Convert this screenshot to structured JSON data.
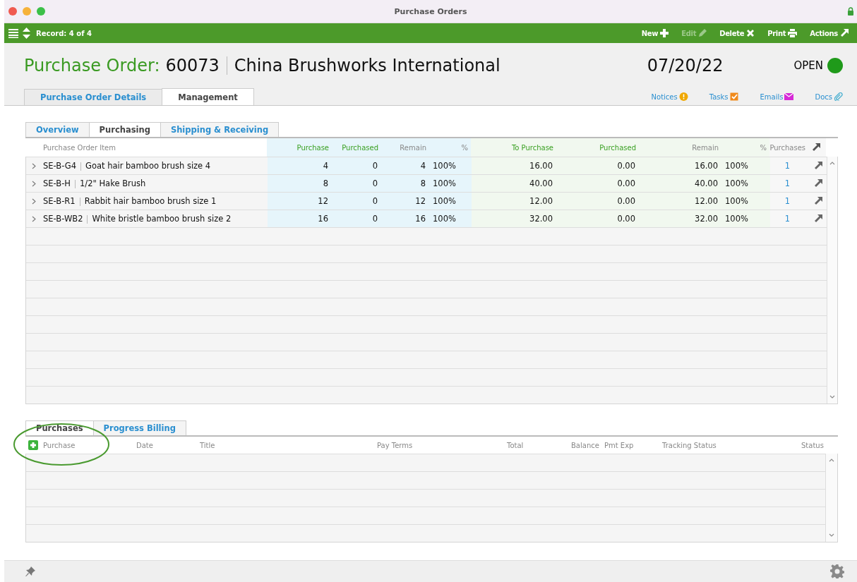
{
  "window": {
    "title": "Purchase Orders"
  },
  "toolbar": {
    "record": "Record: 4 of 4",
    "actions": [
      {
        "label": "New",
        "kind": "plus",
        "disabled": false
      },
      {
        "label": "Edit",
        "kind": "pencil",
        "disabled": true
      },
      {
        "label": "Delete",
        "kind": "cross",
        "disabled": false
      },
      {
        "label": "Print",
        "kind": "printer",
        "disabled": false
      },
      {
        "label": "Actions",
        "kind": "arrow",
        "disabled": false
      }
    ]
  },
  "header": {
    "label": "Purchase Order:",
    "number": "60073",
    "vendor": "China Brushworks International",
    "date": "07/20/22",
    "status": {
      "label": "OPEN",
      "kind": "open"
    }
  },
  "tabs": [
    {
      "label": "Purchase Order Details",
      "selected": false
    },
    {
      "label": "Management",
      "selected": true
    }
  ],
  "links": [
    {
      "label": "Notices",
      "kind": "notice"
    },
    {
      "label": "Tasks",
      "kind": "task"
    },
    {
      "label": "Emails",
      "kind": "email"
    },
    {
      "label": "Docs",
      "kind": "doc"
    }
  ],
  "subtabs": [
    {
      "label": "Overview",
      "selected": false
    },
    {
      "label": "Purchasing",
      "selected": true
    },
    {
      "label": "Shipping & Receiving",
      "selected": false
    }
  ],
  "items_table": {
    "columns": [
      {
        "label": "Purchase Order Item",
        "kind": "item",
        "highlighted": false
      },
      {
        "label": "Purchase",
        "kind": "quantity",
        "highlighted": true
      },
      {
        "label": "Purchased",
        "kind": "quantity",
        "highlighted": true
      },
      {
        "label": "Remain",
        "kind": "quantity",
        "highlighted": false
      },
      {
        "label": "%",
        "kind": "quantity",
        "highlighted": false
      },
      {
        "label": "To Purchase",
        "kind": "cost",
        "highlighted": true
      },
      {
        "label": "Purchased",
        "kind": "cost",
        "highlighted": true
      },
      {
        "label": "Remain",
        "kind": "cost",
        "highlighted": false
      },
      {
        "label": "%",
        "kind": "cost",
        "highlighted": false
      },
      {
        "label": "Purchases",
        "kind": "purchases",
        "highlighted": false
      }
    ],
    "rows": [
      {
        "code": "SE-B-G4",
        "description": "Goat hair bamboo brush size 4",
        "values": [
          "4",
          "0",
          "4",
          "100%",
          "16.00",
          "0.00",
          "16.00",
          "100%",
          "1"
        ]
      },
      {
        "code": "SE-B-H",
        "description": "1/2\" Hake Brush",
        "values": [
          "8",
          "0",
          "8",
          "100%",
          "40.00",
          "0.00",
          "40.00",
          "100%",
          "1"
        ]
      },
      {
        "code": "SE-B-R1",
        "description": "Rabbit hair bamboo brush size 1",
        "values": [
          "12",
          "0",
          "12",
          "100%",
          "12.00",
          "0.00",
          "12.00",
          "100%",
          "1"
        ]
      },
      {
        "code": "SE-B-WB2",
        "description": "White bristle bamboo brush size 2",
        "values": [
          "16",
          "0",
          "16",
          "100%",
          "32.00",
          "0.00",
          "32.00",
          "100%",
          "1"
        ]
      }
    ]
  },
  "bottom_tabs": [
    {
      "label": "Purchases",
      "selected": true
    },
    {
      "label": "Progress Billing",
      "selected": false
    }
  ],
  "purchases_table": {
    "columns": [
      "Purchase",
      "Date",
      "Title",
      "Pay Terms",
      "Total",
      "Balance",
      "Pmt Exp",
      "Tracking Status",
      "Status"
    ]
  }
}
